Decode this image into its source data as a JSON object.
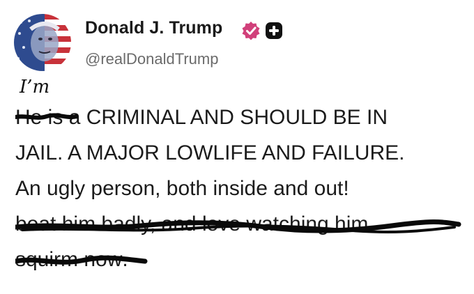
{
  "author": {
    "display_name": "Donald J. Trump",
    "handle": "@realDonaldTrump",
    "verified_icon": "verified-check-badge",
    "extra_badge_icon": "plus-badge",
    "badge_color": "#d1407a"
  },
  "annotation": {
    "handwritten_text": "I’m"
  },
  "post": {
    "line1_struck": "He is",
    "line1_rest": " a CRIMINAL AND SHOULD BE IN",
    "line2": "JAIL. A MAJOR LOWLIFE AND FAILURE.",
    "line3": "An ugly person, both inside and out!",
    "line4_struck": "beat him badly, and love watching him",
    "line5_struck": "squirm now",
    "line5_end": "."
  }
}
